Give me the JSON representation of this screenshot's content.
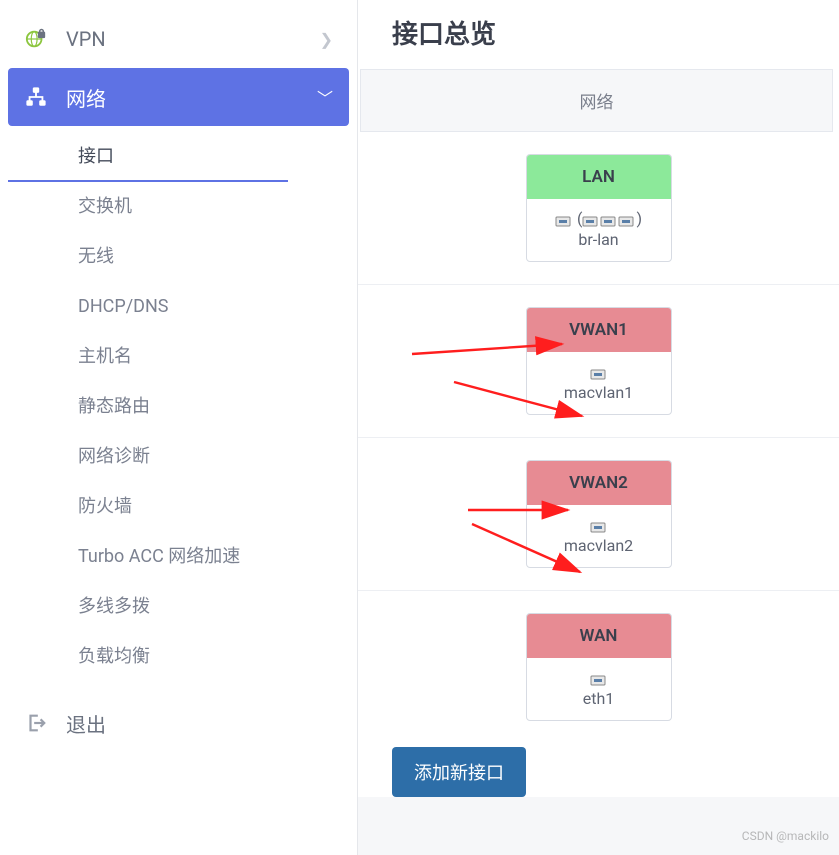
{
  "sidebar": {
    "vpn_label": "VPN",
    "network_label": "网络",
    "logout_label": "退出",
    "items": [
      {
        "label": "接口"
      },
      {
        "label": "交换机"
      },
      {
        "label": "无线"
      },
      {
        "label": "DHCP/DNS"
      },
      {
        "label": "主机名"
      },
      {
        "label": "静态路由"
      },
      {
        "label": "网络诊断"
      },
      {
        "label": "防火墙"
      },
      {
        "label": "Turbo ACC 网络加速"
      },
      {
        "label": "多线多拨"
      },
      {
        "label": "负载均衡"
      }
    ]
  },
  "main": {
    "title": "接口总览",
    "column_header": "网络",
    "add_button": "添加新接口",
    "interfaces": [
      {
        "name": "LAN",
        "device": "br-lan",
        "color": "green",
        "multi_icon": true
      },
      {
        "name": "VWAN1",
        "device": "macvlan1",
        "color": "red",
        "multi_icon": false
      },
      {
        "name": "VWAN2",
        "device": "macvlan2",
        "color": "red",
        "multi_icon": false
      },
      {
        "name": "WAN",
        "device": "eth1",
        "color": "red",
        "multi_icon": false
      }
    ]
  },
  "watermark": "CSDN @mackilo"
}
